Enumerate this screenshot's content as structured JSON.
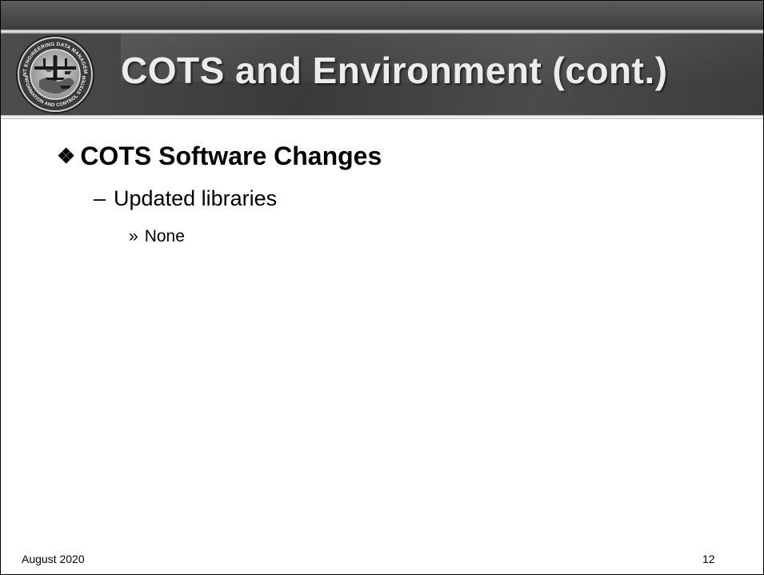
{
  "slide": {
    "title": "COTS and Environment (cont.)",
    "bullets": [
      {
        "marker": "❖",
        "text": "COTS Software Changes"
      },
      {
        "marker": "–",
        "text": "Updated libraries"
      },
      {
        "marker": "»",
        "text": "None"
      }
    ],
    "footer": {
      "date": "August 2020",
      "page_number": "12"
    }
  },
  "logo": {
    "ring_text_top": "JOINT ENGINEERING DATA MANAGEMENT",
    "ring_text_bottom": "INFORMATION AND CONTROL SYSTEM"
  }
}
